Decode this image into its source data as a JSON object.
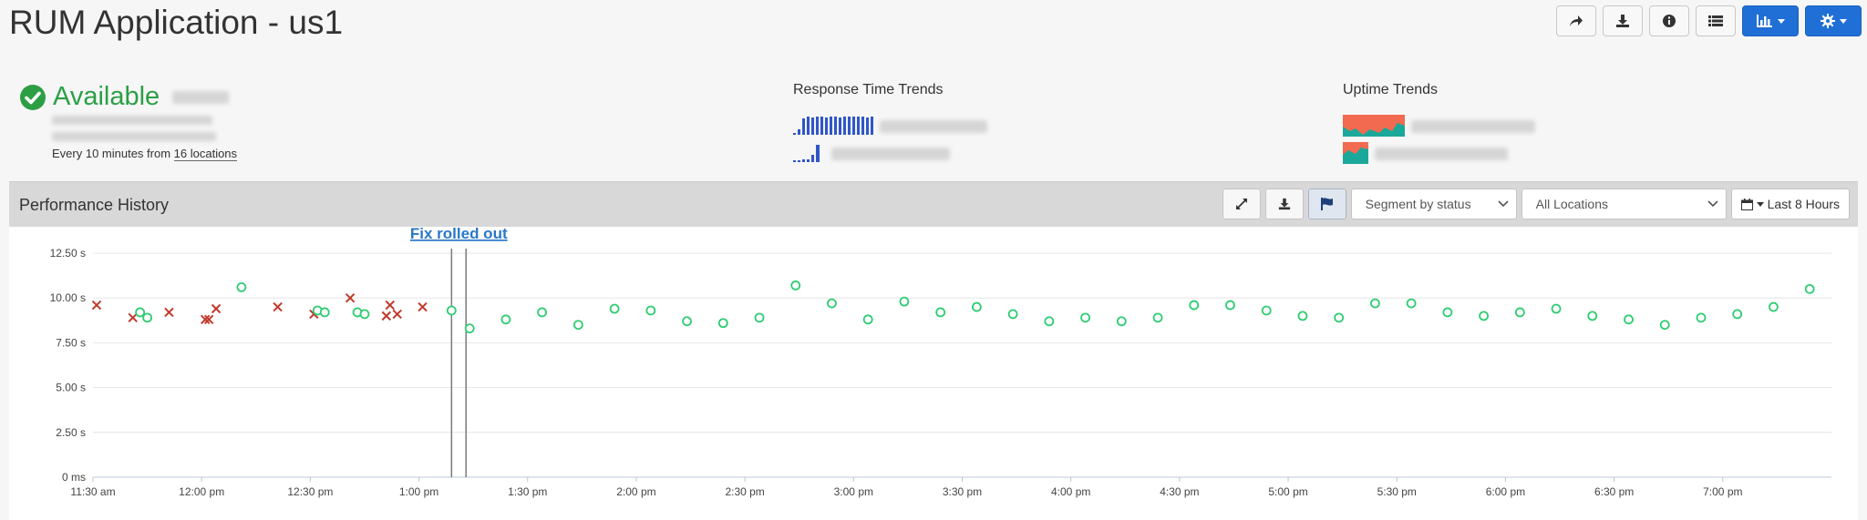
{
  "page": {
    "title": "RUM Application - us1"
  },
  "toolbar": {
    "buttons": [
      {
        "name": "share-button",
        "icon": "share-icon"
      },
      {
        "name": "download-button",
        "icon": "download-icon"
      },
      {
        "name": "info-button",
        "icon": "info-icon"
      },
      {
        "name": "list-button",
        "icon": "list-icon"
      },
      {
        "name": "chart-menu-button",
        "icon": "bar-chart-icon"
      },
      {
        "name": "settings-menu-button",
        "icon": "gear-icon"
      }
    ],
    "accent": "#1f6fd6"
  },
  "summary": {
    "status": "Available",
    "status_color": "#2c9f45",
    "frequency_prefix": "Every 10 minutes from ",
    "locations_link": "16 locations"
  },
  "response_trends": {
    "title": "Response Time Trends",
    "spark_color": "#3056c8"
  },
  "uptime_trends": {
    "title": "Uptime Trends",
    "colors": [
      "#f26a4f",
      "#1aa89a"
    ]
  },
  "performance": {
    "title": "Performance History",
    "segment_select": "Segment by status",
    "location_select": "All Locations",
    "time_range": "Last 8 Hours"
  },
  "chart_data": {
    "type": "scatter",
    "y_ticks": [
      "0 ms",
      "2.50 s",
      "5.00 s",
      "7.50 s",
      "10.00 s",
      "12.50 s"
    ],
    "ylim": [
      0,
      12.5
    ],
    "x_ticks": [
      "11:30 am",
      "12:00 pm",
      "12:30 pm",
      "1:00 pm",
      "1:30 pm",
      "2:00 pm",
      "2:30 pm",
      "3:00 pm",
      "3:30 pm",
      "4:00 pm",
      "4:30 pm",
      "5:00 pm",
      "5:30 pm",
      "6:00 pm",
      "6:30 pm",
      "7:00 pm"
    ],
    "xlim": [
      "11:30",
      "19:30"
    ],
    "annotation": {
      "label": "Fix rolled out",
      "times": [
        "13:09",
        "13:13"
      ]
    },
    "series": [
      {
        "status": "failed",
        "marker": "x",
        "color": "#c0392b",
        "points": [
          {
            "t": "11:31",
            "v": 9.6
          },
          {
            "t": "11:41",
            "v": 8.9
          },
          {
            "t": "11:51",
            "v": 9.2
          },
          {
            "t": "12:01",
            "v": 8.8
          },
          {
            "t": "12:02",
            "v": 8.8
          },
          {
            "t": "12:04",
            "v": 9.4
          },
          {
            "t": "12:21",
            "v": 9.5
          },
          {
            "t": "12:31",
            "v": 9.1
          },
          {
            "t": "12:41",
            "v": 10.0
          },
          {
            "t": "12:51",
            "v": 9.0
          },
          {
            "t": "12:52",
            "v": 9.6
          },
          {
            "t": "12:54",
            "v": 9.1
          },
          {
            "t": "13:01",
            "v": 9.5
          }
        ]
      },
      {
        "status": "success",
        "marker": "o",
        "color": "#2ecc71",
        "points": [
          {
            "t": "11:43",
            "v": 9.2
          },
          {
            "t": "11:45",
            "v": 8.9
          },
          {
            "t": "12:11",
            "v": 10.6
          },
          {
            "t": "12:32",
            "v": 9.3
          },
          {
            "t": "12:34",
            "v": 9.2
          },
          {
            "t": "12:43",
            "v": 9.2
          },
          {
            "t": "12:45",
            "v": 9.1
          },
          {
            "t": "13:09",
            "v": 9.3
          },
          {
            "t": "13:14",
            "v": 8.3
          },
          {
            "t": "13:24",
            "v": 8.8
          },
          {
            "t": "13:34",
            "v": 9.2
          },
          {
            "t": "13:44",
            "v": 8.5
          },
          {
            "t": "13:54",
            "v": 9.4
          },
          {
            "t": "14:04",
            "v": 9.3
          },
          {
            "t": "14:14",
            "v": 8.7
          },
          {
            "t": "14:24",
            "v": 8.6
          },
          {
            "t": "14:34",
            "v": 8.9
          },
          {
            "t": "14:44",
            "v": 10.7
          },
          {
            "t": "14:54",
            "v": 9.7
          },
          {
            "t": "15:04",
            "v": 8.8
          },
          {
            "t": "15:14",
            "v": 9.8
          },
          {
            "t": "15:24",
            "v": 9.2
          },
          {
            "t": "15:34",
            "v": 9.5
          },
          {
            "t": "15:44",
            "v": 9.1
          },
          {
            "t": "15:54",
            "v": 8.7
          },
          {
            "t": "16:04",
            "v": 8.9
          },
          {
            "t": "16:14",
            "v": 8.7
          },
          {
            "t": "16:24",
            "v": 8.9
          },
          {
            "t": "16:34",
            "v": 9.6
          },
          {
            "t": "16:44",
            "v": 9.6
          },
          {
            "t": "16:54",
            "v": 9.3
          },
          {
            "t": "17:04",
            "v": 9.0
          },
          {
            "t": "17:14",
            "v": 8.9
          },
          {
            "t": "17:24",
            "v": 9.7
          },
          {
            "t": "17:34",
            "v": 9.7
          },
          {
            "t": "17:44",
            "v": 9.2
          },
          {
            "t": "17:54",
            "v": 9.0
          },
          {
            "t": "18:04",
            "v": 9.2
          },
          {
            "t": "18:14",
            "v": 9.4
          },
          {
            "t": "18:24",
            "v": 9.0
          },
          {
            "t": "18:34",
            "v": 8.8
          },
          {
            "t": "18:44",
            "v": 8.5
          },
          {
            "t": "18:54",
            "v": 8.9
          },
          {
            "t": "19:04",
            "v": 9.1
          },
          {
            "t": "19:14",
            "v": 9.5
          },
          {
            "t": "19:24",
            "v": 10.5
          }
        ]
      }
    ],
    "grid": true
  }
}
